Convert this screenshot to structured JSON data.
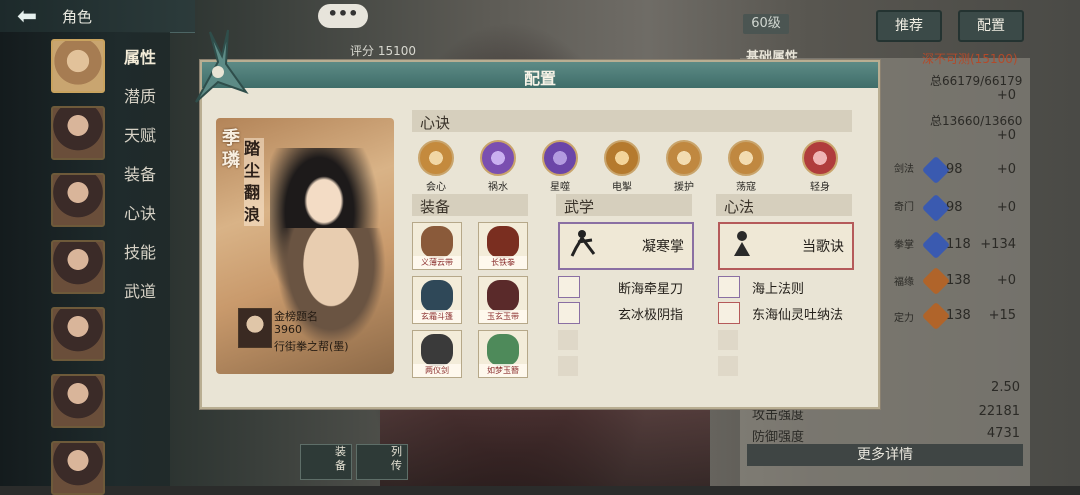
{
  "header": {
    "title": "角色",
    "back_icon": "arrow-left-icon"
  },
  "sidebar": {
    "nav": [
      "属性",
      "潜质",
      "天赋",
      "装备",
      "心诀",
      "技能",
      "武道"
    ],
    "selected": "属性"
  },
  "top": {
    "chat_label": "•••",
    "score_text": "评分 15100"
  },
  "right": {
    "level": "60级",
    "recommend_label": "推荐",
    "config_label": "配置",
    "basic_attrs_label": "基础属性",
    "rank_text": "深不可测(15100)",
    "hp_text": "总66179/66179",
    "hp_delta": "+0",
    "mp_text": "总13660/13660",
    "mp_delta": "+0",
    "stats": [
      {
        "name": "剑法",
        "value": "98",
        "delta": "+0"
      },
      {
        "name": "奇门",
        "value": "98",
        "delta": "+0"
      },
      {
        "name": "拳掌",
        "value": "118",
        "delta": "+134"
      },
      {
        "name": "福缘",
        "value": "138",
        "delta": "+0"
      },
      {
        "name": "定力",
        "value": "138",
        "delta": "+15"
      }
    ],
    "crit_value": "2.50",
    "attack_label": "攻击强度",
    "attack_value": "22181",
    "defense_label": "防御强度",
    "defense_value": "4731",
    "detail_label": "更多详情"
  },
  "bottom": {
    "equip_label": "装备",
    "bio_label": "列传"
  },
  "dialog": {
    "title": "配置",
    "character_name": "季璘",
    "character_title": "踏尘翻浪",
    "owner": {
      "name": "金榜题名",
      "score": "3960",
      "guild": "行街拳之帮(墨)"
    },
    "heart_section": "心诀",
    "heart_skills": [
      {
        "name": "会心",
        "color": "#c48a3d"
      },
      {
        "name": "祸水",
        "color": "#7a4fb0"
      },
      {
        "name": "星噬",
        "color": "#6b45a8"
      },
      {
        "name": "电掣",
        "color": "#b57a2e"
      },
      {
        "name": "援护",
        "color": "#c08840"
      },
      {
        "name": "荡寇",
        "color": "#c08840"
      },
      {
        "name": "轻身",
        "color": "#b03c3c"
      }
    ],
    "equip_section": "装备",
    "equipment": [
      {
        "name": "义薄云带",
        "color": "#8a5a3a"
      },
      {
        "name": "长铁拳",
        "color": "#7a2e20"
      },
      {
        "name": "玄霜斗篷",
        "color": "#2f4858"
      },
      {
        "name": "玉玄玉带",
        "color": "#5a2a2a"
      },
      {
        "name": "两仪剑",
        "color": "#3a3a3a"
      },
      {
        "name": "如梦玉簪",
        "color": "#4e8a5a"
      }
    ],
    "martial_section": "武学",
    "martial_main": "凝寒掌",
    "martial_subs": [
      "断海牵星刀",
      "玄冰极阴指"
    ],
    "heart_method_section": "心法",
    "method_main": "当歌诀",
    "method_subs": [
      "海上法则",
      "东海仙灵吐纳法"
    ]
  }
}
